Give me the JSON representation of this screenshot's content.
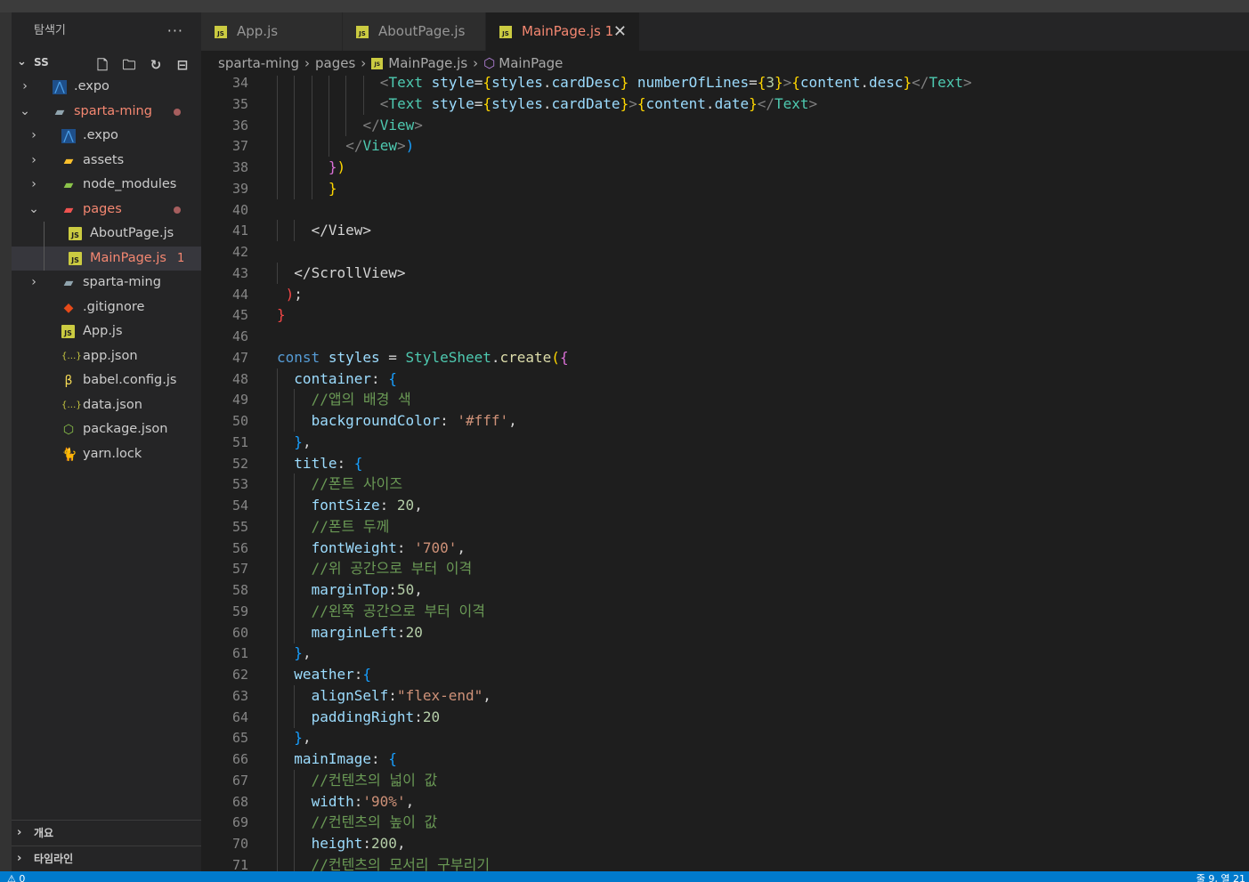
{
  "explorer": {
    "title": "탐색기",
    "more": "···",
    "root": "SS",
    "items": [
      {
        "name": ".expo",
        "type": "folder",
        "icon": "expo-folder-icon",
        "depth": 0
      },
      {
        "name": "sparta-ming",
        "type": "folder-open",
        "icon": "folder-open-icon",
        "depth": 0,
        "modified": true
      },
      {
        "name": ".expo",
        "type": "folder",
        "icon": "expo-folder-icon",
        "depth": 1
      },
      {
        "name": "assets",
        "type": "folder",
        "icon": "assets-folder-icon",
        "depth": 1
      },
      {
        "name": "node_modules",
        "type": "folder",
        "icon": "node-folder-icon",
        "depth": 1
      },
      {
        "name": "pages",
        "type": "folder-open",
        "icon": "pages-folder-icon",
        "depth": 1,
        "modified": true
      },
      {
        "name": "AboutPage.js",
        "type": "file",
        "icon": "js-file-icon",
        "depth": 2
      },
      {
        "name": "MainPage.js",
        "type": "file",
        "icon": "js-file-icon",
        "depth": 2,
        "modified": true,
        "badge": "1",
        "selected": true
      },
      {
        "name": "sparta-ming",
        "type": "folder",
        "icon": "folder-icon",
        "depth": 1
      },
      {
        "name": ".gitignore",
        "type": "file",
        "icon": "git-icon",
        "depth": 1
      },
      {
        "name": "App.js",
        "type": "file",
        "icon": "js-file-icon",
        "depth": 1
      },
      {
        "name": "app.json",
        "type": "file",
        "icon": "json-file-icon",
        "depth": 1
      },
      {
        "name": "babel.config.js",
        "type": "file",
        "icon": "babel-icon",
        "depth": 1
      },
      {
        "name": "data.json",
        "type": "file",
        "icon": "json-file-icon",
        "depth": 1
      },
      {
        "name": "package.json",
        "type": "file",
        "icon": "node-package-icon",
        "depth": 1
      },
      {
        "name": "yarn.lock",
        "type": "file",
        "icon": "yarn-icon",
        "depth": 1
      }
    ],
    "outline": "개요",
    "timeline": "타임라인"
  },
  "tabs": [
    {
      "label": "App.js",
      "active": false
    },
    {
      "label": "AboutPage.js",
      "active": false
    },
    {
      "label": "MainPage.js",
      "badge": "1",
      "active": true
    }
  ],
  "breadcrumb": [
    "sparta-ming",
    "pages",
    "MainPage.js",
    "MainPage"
  ],
  "colors": {
    "accent": "#007acc",
    "modified": "#f48771",
    "js": "#cbcb41"
  },
  "lines": [
    {
      "n": 34,
      "indent": 6,
      "html": "<span class=\"c-br\">&lt;</span><span class=\"c-tag\">Text</span> <span class=\"c-attr\">style</span><span class=\"c-txt\">=</span><span class=\"c-b1\">{</span><span class=\"c-attr\">styles</span><span class=\"c-txt\">.</span><span class=\"c-attr\">cardDesc</span><span class=\"c-b1\">}</span> <span class=\"c-attr\">numberOfLines</span><span class=\"c-txt\">=</span><span class=\"c-b1\">{</span><span class=\"c-num\">3</span><span class=\"c-b1\">}</span><span class=\"c-br\">&gt;</span><span class=\"c-b1\">{</span><span class=\"c-attr\">content</span><span class=\"c-txt\">.</span><span class=\"c-attr\">desc</span><span class=\"c-b1\">}</span><span class=\"c-br\">&lt;/</span><span class=\"c-tag\">Text</span><span class=\"c-br\">&gt;</span>"
    },
    {
      "n": 35,
      "indent": 6,
      "html": "<span class=\"c-br\">&lt;</span><span class=\"c-tag\">Text</span> <span class=\"c-attr\">style</span><span class=\"c-txt\">=</span><span class=\"c-b1\">{</span><span class=\"c-attr\">styles</span><span class=\"c-txt\">.</span><span class=\"c-attr\">cardDate</span><span class=\"c-b1\">}</span><span class=\"c-br\">&gt;</span><span class=\"c-b1\">{</span><span class=\"c-attr\">content</span><span class=\"c-txt\">.</span><span class=\"c-attr\">date</span><span class=\"c-b1\">}</span><span class=\"c-br\">&lt;/</span><span class=\"c-tag\">Text</span><span class=\"c-br\">&gt;</span>"
    },
    {
      "n": 36,
      "indent": 5,
      "html": "<span class=\"c-br\">&lt;/</span><span class=\"c-tag\">View</span><span class=\"c-br\">&gt;</span>"
    },
    {
      "n": 37,
      "indent": 4,
      "html": "<span class=\"c-br\">&lt;/</span><span class=\"c-tag\">View</span><span class=\"c-br\">&gt;</span><span class=\"c-b3\">)</span>"
    },
    {
      "n": 38,
      "indent": 3,
      "html": "<span class=\"c-b2\">}</span><span class=\"c-b1\">)</span>"
    },
    {
      "n": 39,
      "indent": 3,
      "html": "<span class=\"c-b1\">}</span>"
    },
    {
      "n": 40,
      "indent": 0,
      "html": ""
    },
    {
      "n": 41,
      "indent": 2,
      "html": "<span class=\"c-txt\">&lt;/View&gt;</span>"
    },
    {
      "n": 42,
      "indent": 0,
      "html": ""
    },
    {
      "n": 43,
      "indent": 1,
      "html": "<span class=\"c-txt\">&lt;/ScrollView&gt;</span>"
    },
    {
      "n": 44,
      "indent": 0.5,
      "html": "<span class=\"c-red\">)</span><span class=\"c-txt\">;</span>"
    },
    {
      "n": 45,
      "indent": 0,
      "html": "<span class=\"c-red\">}</span>"
    },
    {
      "n": 46,
      "indent": 0,
      "html": ""
    },
    {
      "n": 47,
      "indent": 0,
      "html": "<span class=\"c-kw\">const</span> <span class=\"c-attr\">styles</span> <span class=\"c-txt\">=</span> <span class=\"c-cls\">StyleSheet</span><span class=\"c-txt\">.</span><span class=\"c-fn\">create</span><span class=\"c-b1\">(</span><span class=\"c-b2\">{</span>"
    },
    {
      "n": 48,
      "indent": 1,
      "html": "<span class=\"c-attr\">container</span><span class=\"c-txt\">: </span><span class=\"c-b3\">{</span>"
    },
    {
      "n": 49,
      "indent": 2,
      "html": "<span class=\"c-com\">//앱의 배경 색</span>"
    },
    {
      "n": 50,
      "indent": 2,
      "html": "<span class=\"c-attr\">backgroundColor</span><span class=\"c-txt\">: </span><span class=\"c-str\">'#fff'</span><span class=\"c-txt\">,</span>"
    },
    {
      "n": 51,
      "indent": 1,
      "html": "<span class=\"c-b3\">}</span><span class=\"c-txt\">,</span>"
    },
    {
      "n": 52,
      "indent": 1,
      "html": "<span class=\"c-attr\">title</span><span class=\"c-txt\">: </span><span class=\"c-b3\">{</span>"
    },
    {
      "n": 53,
      "indent": 2,
      "html": "<span class=\"c-com\">//폰트 사이즈</span>"
    },
    {
      "n": 54,
      "indent": 2,
      "html": "<span class=\"c-attr\">fontSize</span><span class=\"c-txt\">: </span><span class=\"c-num\">20</span><span class=\"c-txt\">,</span>"
    },
    {
      "n": 55,
      "indent": 2,
      "html": "<span class=\"c-com\">//폰트 두께</span>"
    },
    {
      "n": 56,
      "indent": 2,
      "html": "<span class=\"c-attr\">fontWeight</span><span class=\"c-txt\">: </span><span class=\"c-str\">'700'</span><span class=\"c-txt\">,</span>"
    },
    {
      "n": 57,
      "indent": 2,
      "html": "<span class=\"c-com\">//위 공간으로 부터 이격</span>"
    },
    {
      "n": 58,
      "indent": 2,
      "html": "<span class=\"c-attr\">marginTop</span><span class=\"c-txt\">:</span><span class=\"c-num\">50</span><span class=\"c-txt\">,</span>"
    },
    {
      "n": 59,
      "indent": 2,
      "html": "<span class=\"c-com\">//왼쪽 공간으로 부터 이격</span>"
    },
    {
      "n": 60,
      "indent": 2,
      "html": "<span class=\"c-attr\">marginLeft</span><span class=\"c-txt\">:</span><span class=\"c-num\">20</span>"
    },
    {
      "n": 61,
      "indent": 1,
      "html": "<span class=\"c-b3\">}</span><span class=\"c-txt\">,</span>"
    },
    {
      "n": 62,
      "indent": 1,
      "html": "<span class=\"c-attr\">weather</span><span class=\"c-txt\">:</span><span class=\"c-b3\">{</span>"
    },
    {
      "n": 63,
      "indent": 2,
      "html": "<span class=\"c-attr\">alignSelf</span><span class=\"c-txt\">:</span><span class=\"c-str\">\"flex-end\"</span><span class=\"c-txt\">,</span>"
    },
    {
      "n": 64,
      "indent": 2,
      "html": "<span class=\"c-attr\">paddingRight</span><span class=\"c-txt\">:</span><span class=\"c-num\">20</span>"
    },
    {
      "n": 65,
      "indent": 1,
      "html": "<span class=\"c-b3\">}</span><span class=\"c-txt\">,</span>"
    },
    {
      "n": 66,
      "indent": 1,
      "html": "<span class=\"c-attr\">mainImage</span><span class=\"c-txt\">: </span><span class=\"c-b3\">{</span>"
    },
    {
      "n": 67,
      "indent": 2,
      "html": "<span class=\"c-com\">//컨텐츠의 넓이 값</span>"
    },
    {
      "n": 68,
      "indent": 2,
      "html": "<span class=\"c-attr\">width</span><span class=\"c-txt\">:</span><span class=\"c-str\">'90%'</span><span class=\"c-txt\">,</span>"
    },
    {
      "n": 69,
      "indent": 2,
      "html": "<span class=\"c-com\">//컨텐츠의 높이 값</span>"
    },
    {
      "n": 70,
      "indent": 2,
      "html": "<span class=\"c-attr\">height</span><span class=\"c-txt\">:</span><span class=\"c-num\">200</span><span class=\"c-txt\">,</span>"
    },
    {
      "n": 71,
      "indent": 2,
      "html": "<span class=\"c-com\">//컨텐츠의 모서리 구부리기</span>"
    }
  ],
  "status": {
    "left": "⚠ 0",
    "right": "줄 9, 열 21"
  }
}
